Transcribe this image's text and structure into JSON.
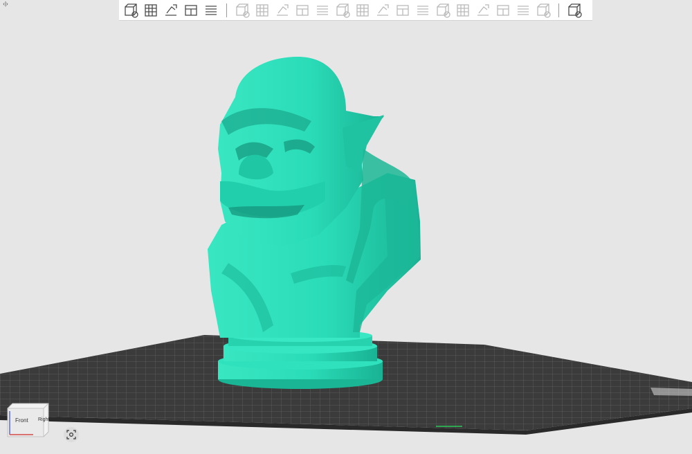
{
  "app": {
    "panel_toggle_glyph": "‹|›"
  },
  "toolbar": {
    "groups": [
      [
        {
          "name": "add-model-icon",
          "enabled": true
        },
        {
          "name": "add-plate-icon",
          "enabled": true
        },
        {
          "name": "auto-orient-icon",
          "enabled": true
        },
        {
          "name": "arrange-icon",
          "enabled": true
        },
        {
          "name": "layers-icon",
          "enabled": true
        }
      ],
      [
        {
          "name": "move-icon",
          "enabled": false
        },
        {
          "name": "rotate-icon",
          "enabled": false
        },
        {
          "name": "scale-icon",
          "enabled": false
        },
        {
          "name": "lay-on-face-icon",
          "enabled": false
        },
        {
          "name": "cut-icon",
          "enabled": false
        },
        {
          "name": "split-icon",
          "enabled": false
        },
        {
          "name": "support-paint-icon",
          "enabled": false
        },
        {
          "name": "seam-paint-icon",
          "enabled": false
        },
        {
          "name": "text-icon",
          "enabled": false
        },
        {
          "name": "measure-icon",
          "enabled": false
        },
        {
          "name": "assembly-icon",
          "enabled": false
        },
        {
          "name": "boolean-icon",
          "enabled": false
        },
        {
          "name": "variable-layer-icon",
          "enabled": false
        },
        {
          "name": "slice-plate-icon",
          "enabled": false
        },
        {
          "name": "print-plate-icon",
          "enabled": false
        },
        {
          "name": "ruler-icon",
          "enabled": false
        }
      ],
      [
        {
          "name": "view-settings-icon",
          "enabled": true
        }
      ]
    ]
  },
  "viewcube": {
    "front_label": "Front",
    "right_label": "Right"
  },
  "colors": {
    "model": "#2ee0bc",
    "model_shadow": "#17a88c",
    "plate": "#3a3a3a",
    "grid_line": "#5a5a5a",
    "background": "#e6e6e6"
  }
}
